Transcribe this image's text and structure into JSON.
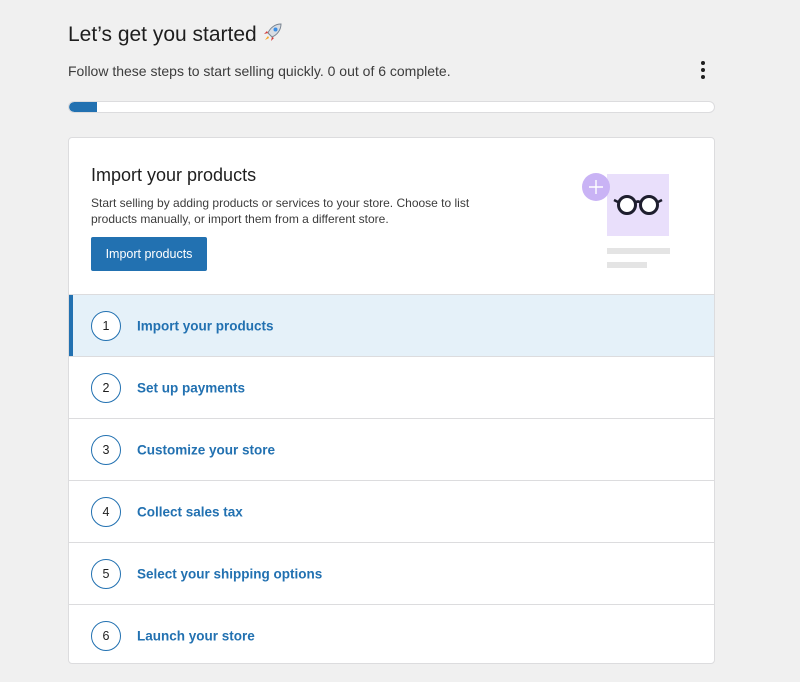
{
  "header": {
    "title": "Let’s get you started",
    "subtitle": "Follow these steps to start selling quickly. 0 out of 6 complete.",
    "menu_icon": "kebab-menu-icon"
  },
  "progress": {
    "completed": 0,
    "total": 6
  },
  "colors": {
    "accent": "#2271b1",
    "active_bg": "#e5f1f9",
    "illustration": "#c9b3f5"
  },
  "hero": {
    "title": "Import your products",
    "description": "Start selling by adding products or services to your store. Choose to list products manually, or import them from a different store.",
    "button_label": "Import products",
    "illustration_icon": "glasses-product-icon"
  },
  "steps": [
    {
      "number": "1",
      "label": "Import your products"
    },
    {
      "number": "2",
      "label": "Set up payments"
    },
    {
      "number": "3",
      "label": "Customize your store"
    },
    {
      "number": "4",
      "label": "Collect sales tax"
    },
    {
      "number": "5",
      "label": "Select your shipping options"
    },
    {
      "number": "6",
      "label": "Launch your store"
    }
  ]
}
